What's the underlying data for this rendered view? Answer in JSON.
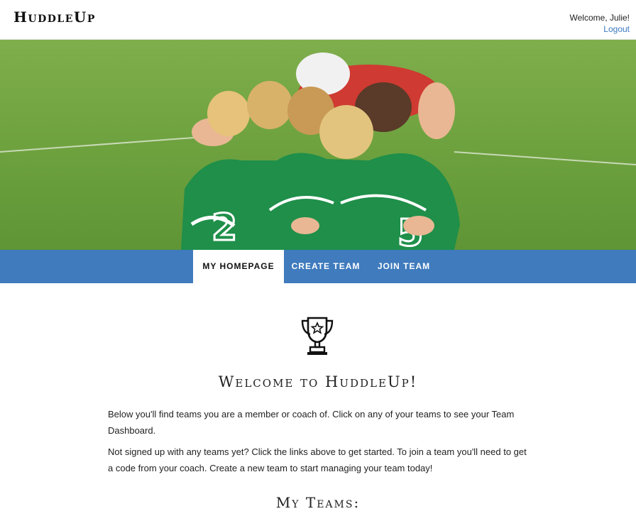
{
  "header": {
    "logo": "HuddleUp",
    "welcome": "Welcome, Julie!",
    "logout": "Logout"
  },
  "hero": {
    "icon": "team-huddle-photo"
  },
  "nav": {
    "tabs": [
      {
        "label": "MY HOMEPAGE",
        "active": true
      },
      {
        "label": "CREATE TEAM",
        "active": false
      },
      {
        "label": "JOIN TEAM",
        "active": false
      }
    ]
  },
  "main": {
    "icon": "trophy-icon",
    "title": "Welcome to HuddleUp!",
    "paragraph1": "Below you'll find teams you are a member or coach of. Click on any of your teams to see your Team Dashboard.",
    "paragraph2": "Not signed up with any teams yet? Click the links above to get started. To join a team you'll need to get a code from your coach. Create a new team to start managing your team today!",
    "teams_heading": "My Teams:"
  },
  "colors": {
    "nav_bg": "#3f7bbd",
    "link": "#3b78c0",
    "jersey_green": "#1f8f4a"
  }
}
